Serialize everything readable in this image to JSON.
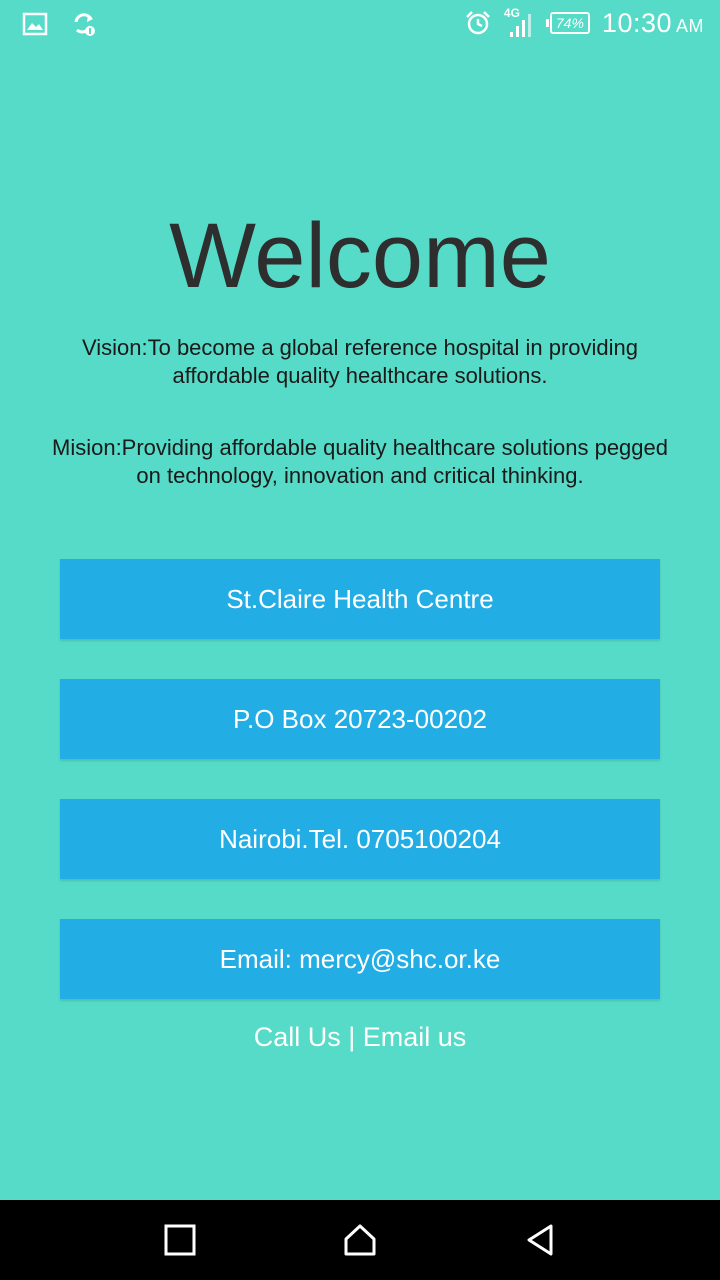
{
  "status_bar": {
    "left_icons": [
      "image-icon",
      "sync-icon"
    ],
    "right_icons": [
      "alarm-icon",
      "signal-4g-icon",
      "battery-icon"
    ],
    "network": "4G",
    "battery": "74%",
    "time": "10:30",
    "ampm": "AM"
  },
  "main": {
    "title": "Welcome",
    "vision": "Vision:To become a global reference hospital in providing affordable quality healthcare solutions.",
    "mission": "Mision:Providing affordable quality healthcare solutions pegged on technology, innovation and critical thinking.",
    "buttons": [
      {
        "label": "St.Claire Health Centre"
      },
      {
        "label": "P.O Box 20723-00202"
      },
      {
        "label": "Nairobi.Tel. 0705100204"
      },
      {
        "label": "Email: mercy@shc.or.ke"
      }
    ],
    "links": {
      "call": "Call Us",
      "separator": " | ",
      "email": "Email us"
    }
  },
  "nav_bar": {
    "icons": [
      "recent-apps-icon",
      "home-icon",
      "back-icon"
    ]
  },
  "colors": {
    "background": "#55dbc7",
    "button": "#23ade5",
    "title": "#2e2e2e"
  }
}
